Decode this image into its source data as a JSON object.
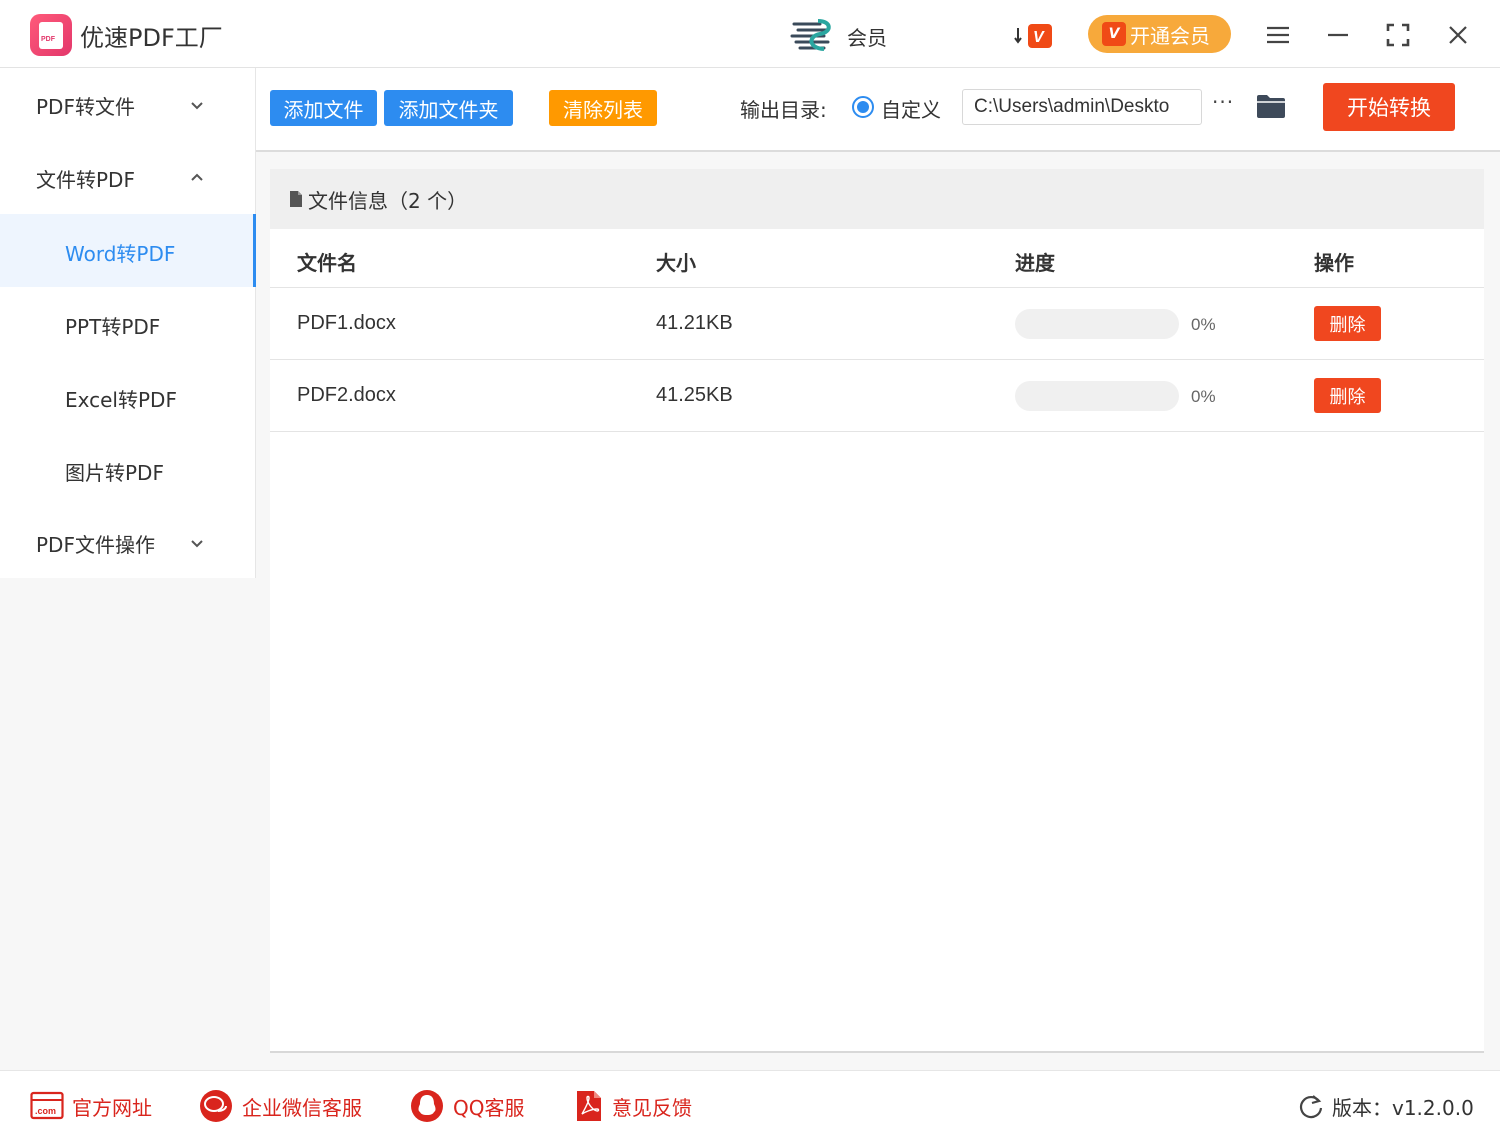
{
  "app": {
    "title": "优速PDF工厂"
  },
  "titlebar": {
    "member_label": "会员",
    "vip_button_label": "开通会员",
    "vip_icon_text": "V"
  },
  "sidebar": {
    "groups": [
      {
        "label": "PDF转文件",
        "expanded": false
      },
      {
        "label": "文件转PDF",
        "expanded": true
      },
      {
        "label": "PDF文件操作",
        "expanded": false
      }
    ],
    "items": [
      {
        "label": "Word转PDF",
        "active": true
      },
      {
        "label": "PPT转PDF",
        "active": false
      },
      {
        "label": "Excel转PDF",
        "active": false
      },
      {
        "label": "图片转PDF",
        "active": false
      }
    ]
  },
  "toolbar": {
    "add_file": "添加文件",
    "add_folder": "添加文件夹",
    "clear_list": "清除列表",
    "output_label": "输出目录:",
    "radio_label": "自定义",
    "path_value": "C:\\Users\\admin\\Deskto",
    "more": "···",
    "start": "开始转换"
  },
  "file_panel": {
    "info_label": "文件信息（2 个）",
    "columns": [
      "文件名",
      "大小",
      "进度",
      "操作"
    ],
    "rows": [
      {
        "name": "PDF1.docx",
        "size": "41.21KB",
        "progress": 0,
        "progress_text": "0%",
        "action": "删除"
      },
      {
        "name": "PDF2.docx",
        "size": "41.25KB",
        "progress": 0,
        "progress_text": "0%",
        "action": "删除"
      }
    ]
  },
  "footer": {
    "links": [
      "官方网址",
      "企业微信客服",
      "QQ客服",
      "意见反馈"
    ],
    "com_text": ".com",
    "version": "版本：v1.2.0.0"
  },
  "colors": {
    "primary": "#2d8cf0",
    "danger": "#f0471f",
    "warning": "#ff9900",
    "vip": "#f7a93b",
    "footer_link": "#d9251d"
  }
}
